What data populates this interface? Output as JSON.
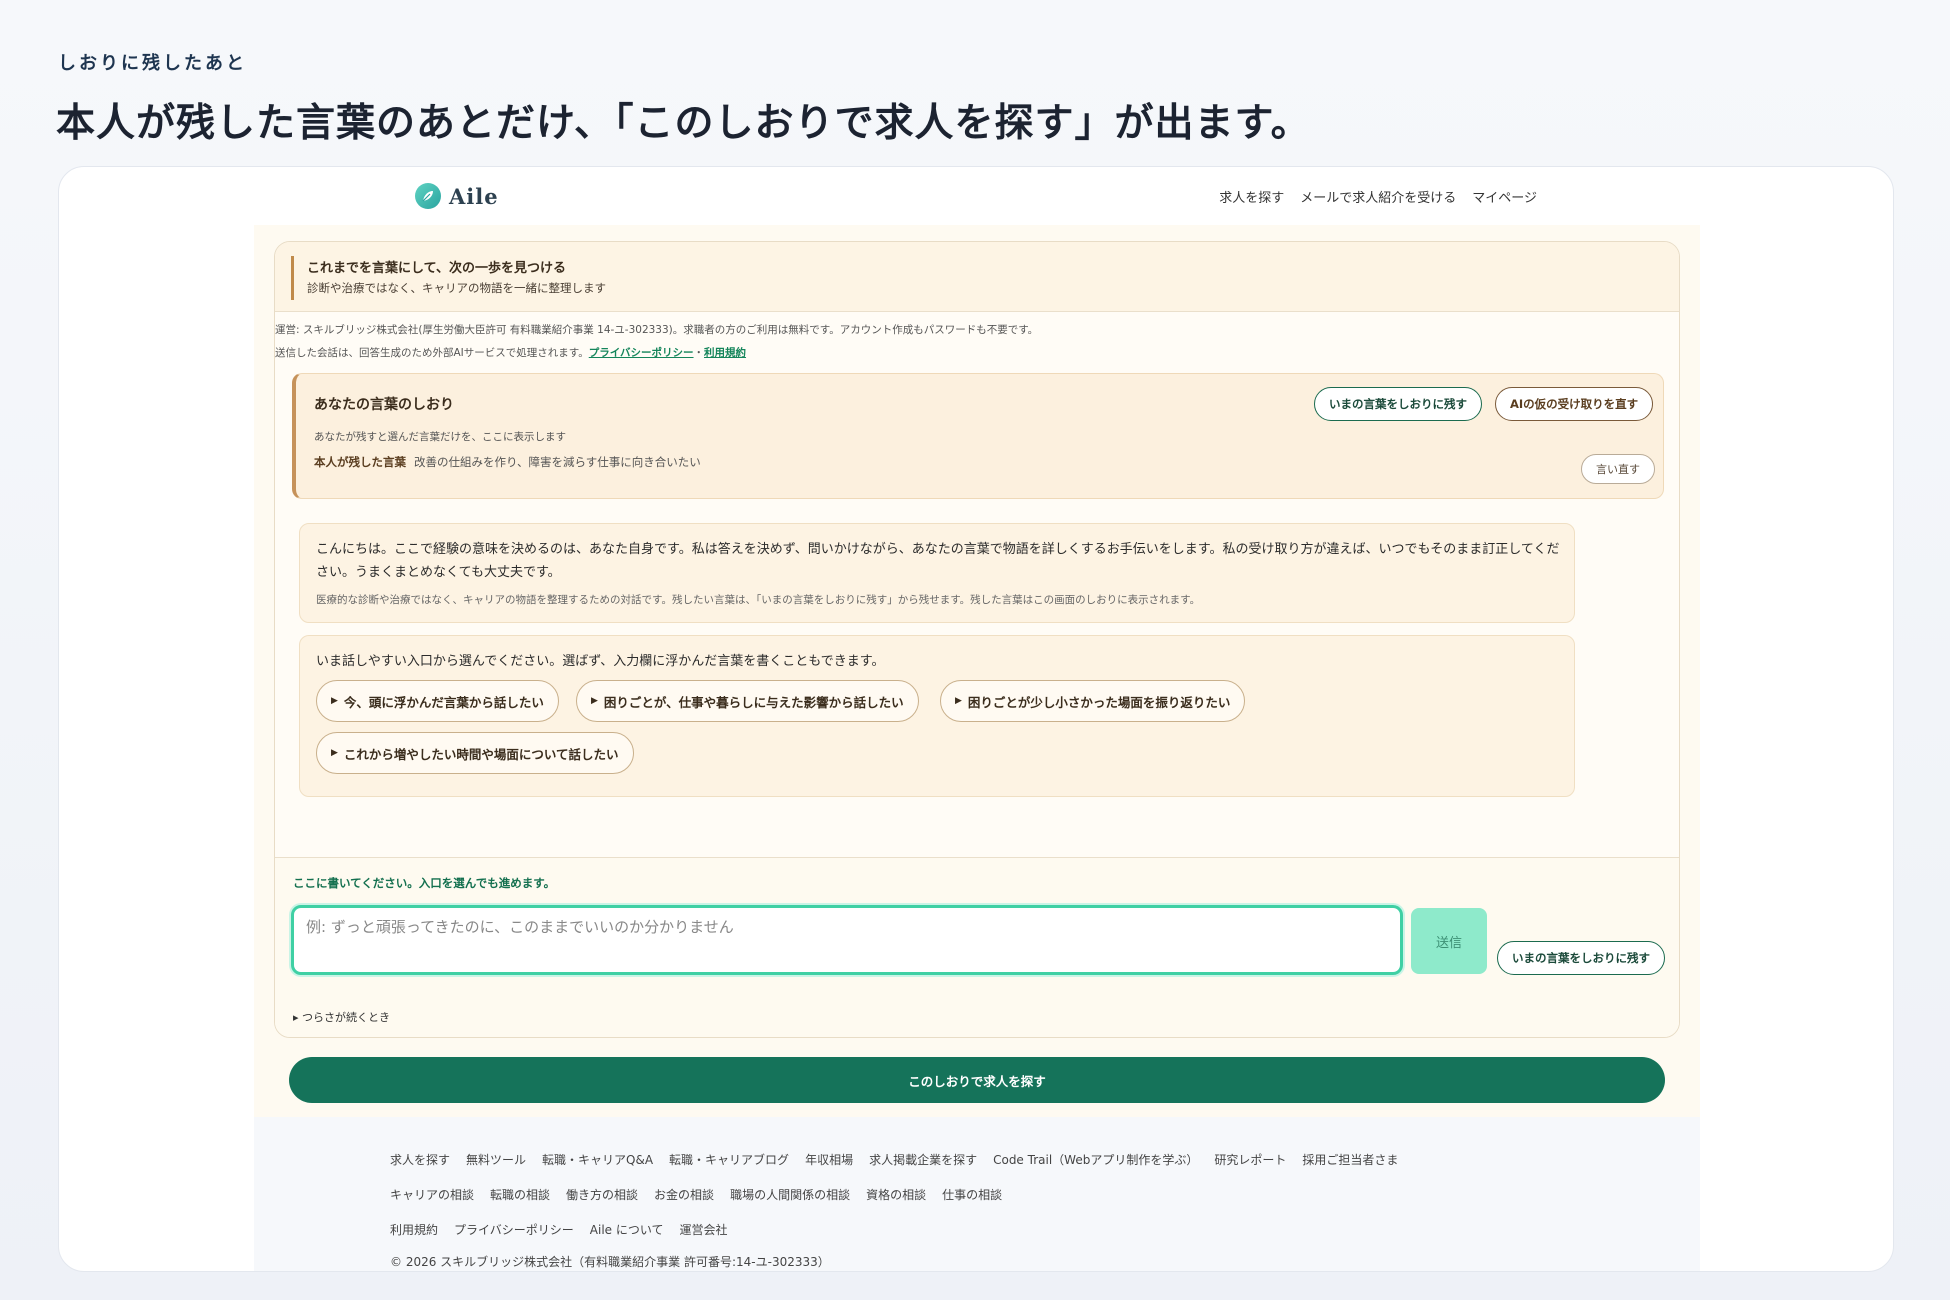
{
  "caption": {
    "eyebrow": "しおりに残したあと",
    "headline": "本人が残した言葉のあとだけ、「このしおりで求人を探す」が出ます。"
  },
  "brand": {
    "name": "Aile",
    "logo_icon": "leaf-icon"
  },
  "nav": {
    "items": [
      "求人を探す",
      "メールで求人紹介を受ける",
      "マイページ"
    ]
  },
  "panel": {
    "title": "これまでを言葉にして、次の一歩を見つける",
    "subtitle": "診断や治療ではなく、キャリアの物語を一緒に整理します"
  },
  "notice": {
    "line1": "運営: スキルブリッジ株式会社(厚生労働大臣許可 有料職業紹介事業 14-ユ-302333)。求職者の方のご利用は無料です。アカウント作成もパスワードも不要です。",
    "line2_prefix": "送信した会話は、回答生成のため外部AIサービスで処理されます。",
    "privacy_link": "プライバシーポリシー",
    "separator": "・",
    "terms_link": "利用規約"
  },
  "bookmark": {
    "title": "あなたの言葉のしおり",
    "subtitle": "あなたが残すと選んだ言葉だけを、ここに表示します",
    "kept_label": "本人が残した言葉",
    "kept_text": "改善の仕組みを作り、障害を減らす仕事に向き合いたい",
    "save_button": "いまの言葉をしおりに残す",
    "redo_button": "AIの仮の受け取りを直す",
    "rephrase_button": "言い直す"
  },
  "messages": {
    "greeting": "こんにちは。ここで経験の意味を決めるのは、あなた自身です。私は答えを決めず、問いかけながら、あなたの言葉で物語を詳しくするお手伝いをします。私の受け取り方が違えば、いつでもそのまま訂正してください。うまくまとめなくても大丈夫です。",
    "greeting_note": "医療的な診断や治療ではなく、キャリアの物語を整理するための対話です。残したい言葉は、「いまの言葉をしおりに残す」から残せます。残した言葉はこの画面のしおりに表示されます。",
    "prompt": "いま話しやすい入口から選んでください。選ばず、入力欄に浮かんだ言葉を書くこともできます。",
    "chips": [
      "今、頭に浮かんだ言葉から話したい",
      "困りごとが、仕事や暮らしに与えた影響から話したい",
      "困りごとが少し小さかった場面を振り返りたい",
      "これから増やしたい時間や場面について話したい"
    ]
  },
  "composer": {
    "hint": "ここに書いてください。入口を選んでも進めます。",
    "placeholder": "例: ずっと頑張ってきたのに、このままでいいのか分かりません",
    "value": "",
    "send_label": "送信",
    "save_button": "いまの言葉をしおりに残す",
    "tough_toggle": "つらさが続くとき"
  },
  "cta": {
    "label": "このしおりで求人を探す"
  },
  "footer": {
    "row1": [
      "求人を探す",
      "無料ツール",
      "転職・キャリアQ&A",
      "転職・キャリアブログ",
      "年収相場",
      "求人掲載企業を探す",
      "Code Trail（Webアプリ制作を学ぶ）",
      "研究レポート",
      "採用ご担当者さま"
    ],
    "row2": [
      "キャリアの相談",
      "転職の相談",
      "働き方の相談",
      "お金の相談",
      "職場の人間関係の相談",
      "資格の相談",
      "仕事の相談"
    ],
    "row3": [
      "利用規約",
      "プライバシーポリシー",
      "Aile について",
      "運営会社"
    ],
    "copyright": "© 2026 スキルブリッジ株式会社（有料職業紹介事業 許可番号:14-ユ-302333）"
  },
  "colors": {
    "accent_green": "#15735a",
    "input_focus": "#3fd0a4",
    "send_bg": "#8eeacb",
    "bookmark_border": "#c6925a"
  }
}
